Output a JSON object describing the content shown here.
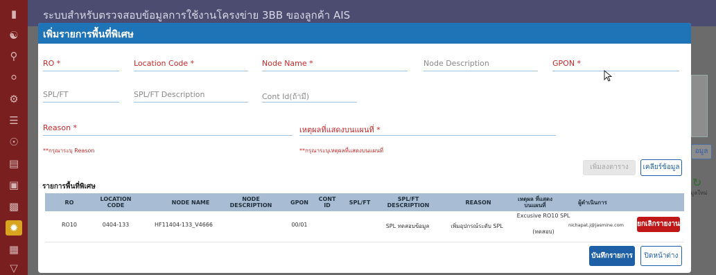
{
  "app": {
    "title": "ระบบสำหรับตรวจสอบข้อมูลการใช้งานโครงข่าย 3BB ของลูกค้า AIS"
  },
  "sidebar": {
    "items": [
      {
        "icon": "megaphone-icon"
      },
      {
        "icon": "user-group-icon"
      },
      {
        "icon": "search-icon"
      },
      {
        "icon": "user-search-icon"
      },
      {
        "icon": "chat-settings-icon"
      },
      {
        "icon": "document-gear-icon"
      },
      {
        "icon": "radar-icon"
      },
      {
        "icon": "report-icon"
      },
      {
        "icon": "printer-report-icon"
      },
      {
        "icon": "printer-icon"
      },
      {
        "icon": "special-area-icon"
      },
      {
        "icon": "document-list-icon"
      },
      {
        "icon": "chevron-down-icon"
      }
    ],
    "active_index": 10
  },
  "background": {
    "right_button": "อมูล",
    "right_text": "มูลใหม่"
  },
  "modal": {
    "title": "เพิ่มรายการพื้นที่พิเศษ",
    "fields": {
      "ro": "RO *",
      "location_code": "Location Code *",
      "node_name": "Node Name *",
      "node_description": "Node Description",
      "gpon": "GPON *",
      "spl_ft": "SPL/FT",
      "spl_ft_description": "SPL/FT Description",
      "cont_id": "Cont Id(ถ้ามี)",
      "reason": "Reason *",
      "map_reason": "เหตุผลที่แสดงบนแผนที่ *"
    },
    "errors": {
      "reason": "**กรุณาระบุ Reason",
      "map_reason": "**กรุณาระบุเหตุผลที่แสดงบนแผนที่"
    },
    "buttons": {
      "add_to_table": "เพิ่มลงตาราง",
      "clear": "เคลียร์ข้อมูล",
      "save": "บันทึกรายการ",
      "close": "ปิดหน้าต่าง"
    },
    "table": {
      "title": "รายการพื้นที่พิเศษ",
      "headers": [
        "RO",
        "LOCATION CODE",
        "NODE NAME",
        "NODE DESCRIPTION",
        "GPON",
        "CONT ID",
        "SPL/FT",
        "SPL/FT DESCRIPTION",
        "REASON",
        "เหตุผล ที่แสดงบนแผนที่",
        "ผู้ดำเนินการ"
      ],
      "rows": [
        {
          "ro": "RO10",
          "location_code": "0404-133",
          "node_name": "HF11404-133_V4666",
          "node_description": "",
          "gpon": "00/01",
          "cont_id": "",
          "spl_ft": "",
          "spl_ft_description": "SPL ทดสอบข้อมูล",
          "reason": "เพิ่มอุปกรณ์ระดับ SPL",
          "map_reason_line1": "Excusive RO10 SPL",
          "map_reason_line2": "(ทดสอบ)",
          "operator": "nichapat.j@jasmine.com",
          "action": "ยกเลิกรายงาน"
        }
      ]
    }
  }
}
